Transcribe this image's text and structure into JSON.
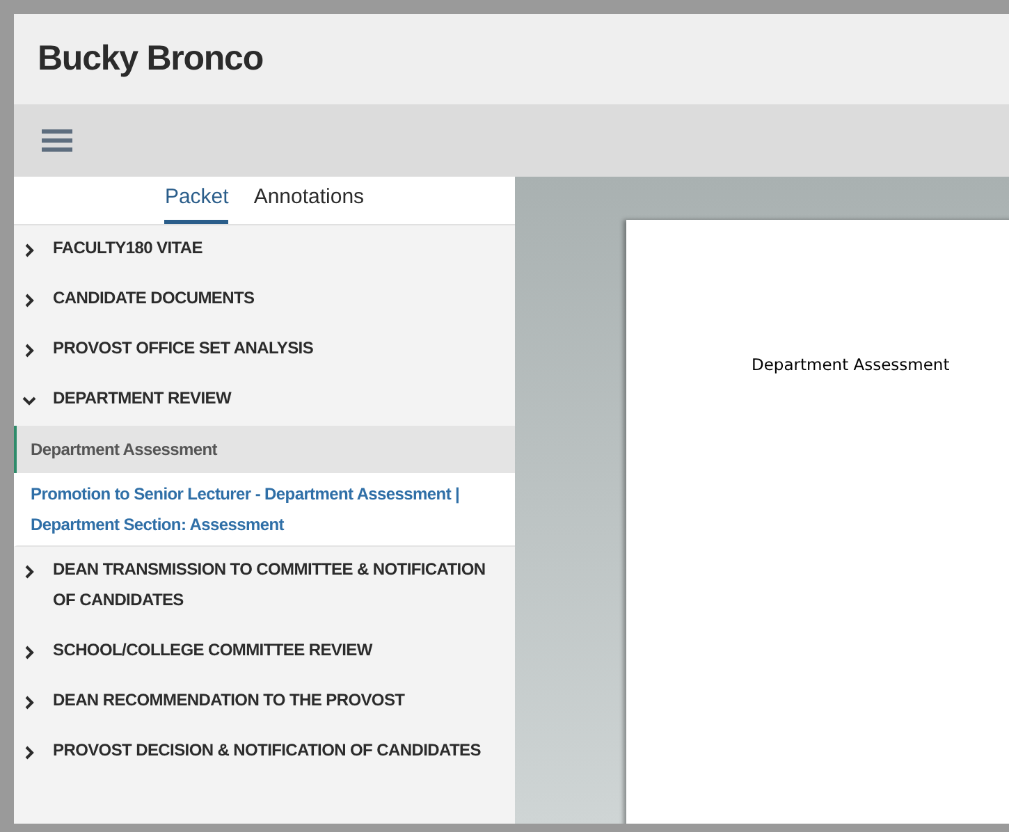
{
  "header": {
    "title": "Bucky Bronco"
  },
  "tabs": [
    {
      "label": "Packet",
      "selected": true
    },
    {
      "label": "Annotations",
      "selected": false
    }
  ],
  "sections": [
    {
      "label": "FACULTY180 VITAE",
      "expanded": false
    },
    {
      "label": "CANDIDATE DOCUMENTS",
      "expanded": false
    },
    {
      "label": "PROVOST OFFICE SET ANALYSIS",
      "expanded": false
    },
    {
      "label": "DEPARTMENT REVIEW",
      "expanded": true,
      "children": [
        {
          "kind": "heading",
          "label": "Department Assessment",
          "selected": true
        },
        {
          "kind": "link",
          "label": "Promotion to Senior Lecturer - Department Assessment | Department Section: Assessment",
          "selected": false
        }
      ]
    },
    {
      "label": "DEAN TRANSMISSION TO COMMITTEE & NOTIFICATION OF CANDIDATES",
      "expanded": false
    },
    {
      "label": "SCHOOL/COLLEGE COMMITTEE REVIEW",
      "expanded": false
    },
    {
      "label": "DEAN RECOMMENDATION TO THE PROVOST",
      "expanded": false
    },
    {
      "label": "PROVOST DECISION & NOTIFICATION OF CANDIDATES",
      "expanded": false
    }
  ],
  "document": {
    "page_text": "Department Assessment"
  }
}
